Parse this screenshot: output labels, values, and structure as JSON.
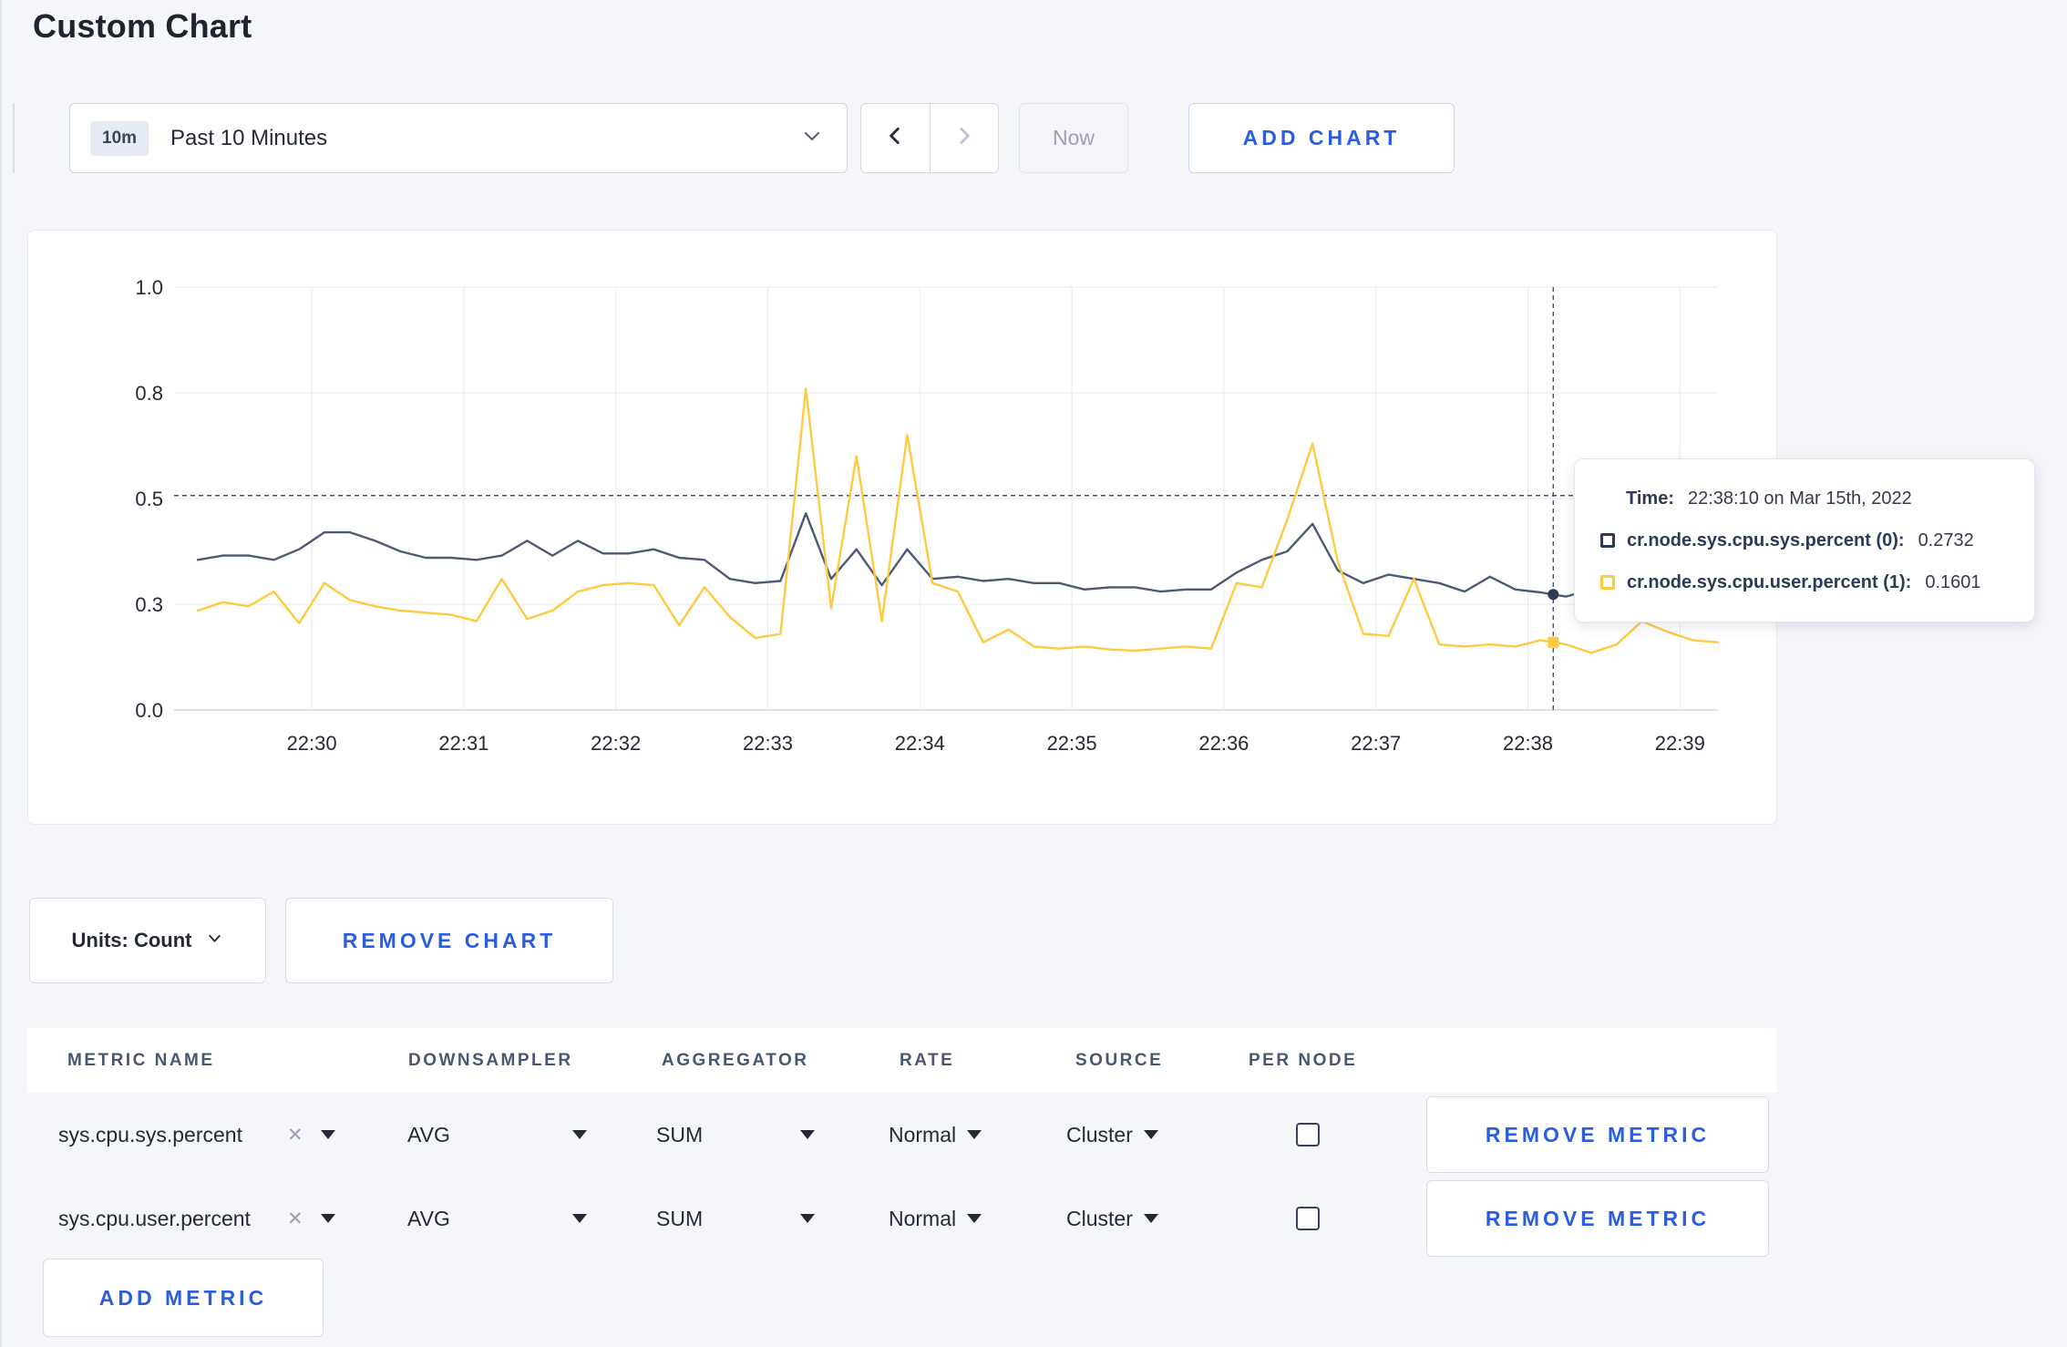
{
  "page": {
    "title": "Custom Chart",
    "background_color": "#f5f6fa",
    "accent_blue": "#2b5de0"
  },
  "toolbar": {
    "time_range": {
      "badge": "10m",
      "label": "Past 10 Minutes"
    },
    "now_label": "Now",
    "add_chart_label": "ADD CHART"
  },
  "chart_card": {
    "units_label": "Units: Count",
    "remove_chart_label": "REMOVE CHART"
  },
  "tooltip": {
    "time_label": "Time:",
    "time_value": "22:38:10 on Mar 15th, 2022",
    "series": [
      {
        "name": "cr.node.sys.cpu.sys.percent (0):",
        "value": "0.2732",
        "color": "#2c3a57"
      },
      {
        "name": "cr.node.sys.cpu.user.percent (1):",
        "value": "0.1601",
        "color": "#fdca40"
      }
    ]
  },
  "chart_data": {
    "type": "line",
    "title": "",
    "xlabel": "",
    "ylabel": "",
    "grid": true,
    "legend_position": "tooltip",
    "x_axis": {
      "tick_labels": [
        "22:30",
        "22:31",
        "22:32",
        "22:33",
        "22:34",
        "22:35",
        "22:36",
        "22:37",
        "22:38",
        "22:39"
      ],
      "start_time": "22:29:15",
      "interval_seconds": 10
    },
    "y_axis": {
      "range": [
        0,
        1
      ],
      "tick_values": [
        0,
        0.25,
        0.5,
        0.75,
        1.0
      ],
      "tick_labels": [
        "0.0",
        "0.3",
        "0.5",
        "0.8",
        "1.0"
      ]
    },
    "series": [
      {
        "name": "cr.node.sys.cpu.sys.percent",
        "color": "#4c5a75",
        "values": [
          0.355,
          0.365,
          0.365,
          0.355,
          0.38,
          0.42,
          0.42,
          0.4,
          0.375,
          0.36,
          0.36,
          0.355,
          0.365,
          0.4,
          0.365,
          0.4,
          0.37,
          0.37,
          0.38,
          0.36,
          0.355,
          0.31,
          0.3,
          0.305,
          0.465,
          0.31,
          0.38,
          0.295,
          0.38,
          0.31,
          0.315,
          0.305,
          0.31,
          0.3,
          0.3,
          0.285,
          0.29,
          0.29,
          0.28,
          0.285,
          0.285,
          0.325,
          0.355,
          0.375,
          0.44,
          0.33,
          0.3,
          0.32,
          0.31,
          0.3,
          0.28,
          0.315,
          0.285,
          0.278,
          0.268,
          0.285,
          0.295,
          0.3,
          0.295,
          0.3,
          0.295
        ]
      },
      {
        "name": "cr.node.sys.cpu.user.percent",
        "color": "#fdca40",
        "values": [
          0.235,
          0.255,
          0.245,
          0.28,
          0.205,
          0.3,
          0.26,
          0.245,
          0.235,
          0.23,
          0.225,
          0.21,
          0.31,
          0.215,
          0.235,
          0.28,
          0.295,
          0.3,
          0.295,
          0.2,
          0.29,
          0.22,
          0.17,
          0.18,
          0.76,
          0.24,
          0.6,
          0.21,
          0.65,
          0.3,
          0.28,
          0.16,
          0.19,
          0.15,
          0.145,
          0.15,
          0.143,
          0.14,
          0.145,
          0.15,
          0.145,
          0.3,
          0.29,
          0.45,
          0.63,
          0.35,
          0.18,
          0.175,
          0.31,
          0.155,
          0.15,
          0.155,
          0.15,
          0.165,
          0.155,
          0.135,
          0.155,
          0.21,
          0.185,
          0.165,
          0.16
        ]
      }
    ],
    "crosshair": {
      "time": "22:38:10",
      "x_index": 53.5,
      "cursor_y_value": 0.507,
      "markers": [
        {
          "series": "cr.node.sys.cpu.sys.percent",
          "value": 0.2732
        },
        {
          "series": "cr.node.sys.cpu.user.percent",
          "value": 0.1601
        }
      ]
    }
  },
  "metrics_table": {
    "headers": [
      "METRIC NAME",
      "DOWNSAMPLER",
      "AGGREGATOR",
      "RATE",
      "SOURCE",
      "PER NODE"
    ],
    "rows": [
      {
        "metric": "sys.cpu.sys.percent",
        "downsampler": "AVG",
        "aggregator": "SUM",
        "rate": "Normal",
        "source": "Cluster",
        "per_node": false,
        "remove_label": "REMOVE METRIC"
      },
      {
        "metric": "sys.cpu.user.percent",
        "downsampler": "AVG",
        "aggregator": "SUM",
        "rate": "Normal",
        "source": "Cluster",
        "per_node": false,
        "remove_label": "REMOVE METRIC"
      }
    ],
    "add_metric_label": "ADD METRIC"
  }
}
